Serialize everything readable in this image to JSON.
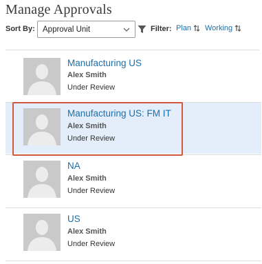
{
  "page": {
    "title": "Manage Approvals"
  },
  "toolbar": {
    "sort_label": "Sort By:",
    "sort_value": "Approval Unit",
    "filter_label": "Filter:",
    "filters": [
      {
        "label": "Plan",
        "icon": "swap-icon"
      },
      {
        "label": "Working",
        "icon": "swap-icon"
      }
    ]
  },
  "items": [
    {
      "name": "Manufacturing US",
      "owner": "Alex Smith",
      "status": "Under Review",
      "selected": false
    },
    {
      "name": "Manufacturing US: FM IT",
      "owner": "Alex Smith",
      "status": "Under Review",
      "selected": true
    },
    {
      "name": "NA",
      "owner": "Alex Smith",
      "status": "Under Review",
      "selected": false
    },
    {
      "name": "US",
      "owner": "Alex Smith",
      "status": "Under Review",
      "selected": false
    }
  ],
  "colors": {
    "link": "#1a6ea9",
    "selected_bg": "#e4eefb",
    "highlight_border": "#d0573c",
    "avatar_bg": "#c9c9c9"
  }
}
